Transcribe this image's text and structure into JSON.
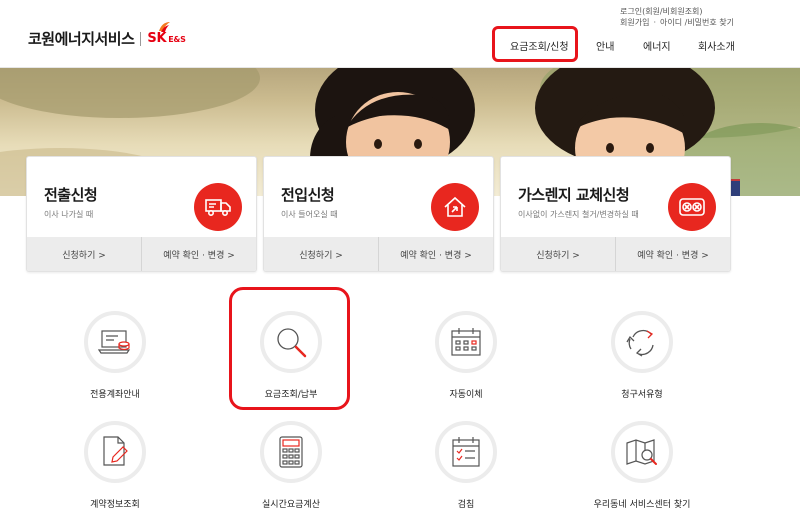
{
  "brand": {
    "name": "코원에너지서비스",
    "partner": "SK",
    "partner_sub": "E&S"
  },
  "util": {
    "row1": [
      "로그인(회원/비회원조회)"
    ],
    "row2": [
      "회원가입",
      "·",
      "아이디 /비밀번호 찾기"
    ]
  },
  "nav": [
    {
      "label": "요금조회/신청"
    },
    {
      "label": "안내"
    },
    {
      "label": "에너지"
    },
    {
      "label": "회사소개"
    }
  ],
  "cards": [
    {
      "title": "전출신청",
      "desc": "이사 나가실 때",
      "icon": "moving-truck-icon",
      "actions": [
        "신청하기 >",
        "예약 확인 · 변경 >"
      ]
    },
    {
      "title": "전입신청",
      "desc": "이사 들어오실 때",
      "icon": "house-move-in-icon",
      "actions": [
        "신청하기 >",
        "예약 확인 · 변경 >"
      ]
    },
    {
      "title": "가스렌지 교체신청",
      "desc": "이사없이 가스렌지 철거/변경하실 때",
      "icon": "gas-range-icon",
      "actions": [
        "신청하기 >",
        "예약 확인 · 변경 >"
      ]
    }
  ],
  "quick_menu": [
    {
      "label": "전용계좌안내",
      "icon": "laptop-account-icon"
    },
    {
      "label": "요금조회/납부",
      "icon": "magnifier-icon"
    },
    {
      "label": "자동이체",
      "icon": "calendar-icon"
    },
    {
      "label": "청구서유형",
      "icon": "recycle-arrows-icon"
    },
    {
      "label": "계약정보조회",
      "icon": "document-pen-icon"
    },
    {
      "label": "실시간요금계산",
      "icon": "calculator-icon"
    },
    {
      "label": "검침",
      "icon": "checklist-calendar-icon"
    },
    {
      "label": "우리동네 서비스센터 찾기",
      "icon": "map-search-icon"
    }
  ],
  "colors": {
    "accent": "#e8271f",
    "highlight": "#e8141b",
    "card_bar": "#ececec"
  }
}
